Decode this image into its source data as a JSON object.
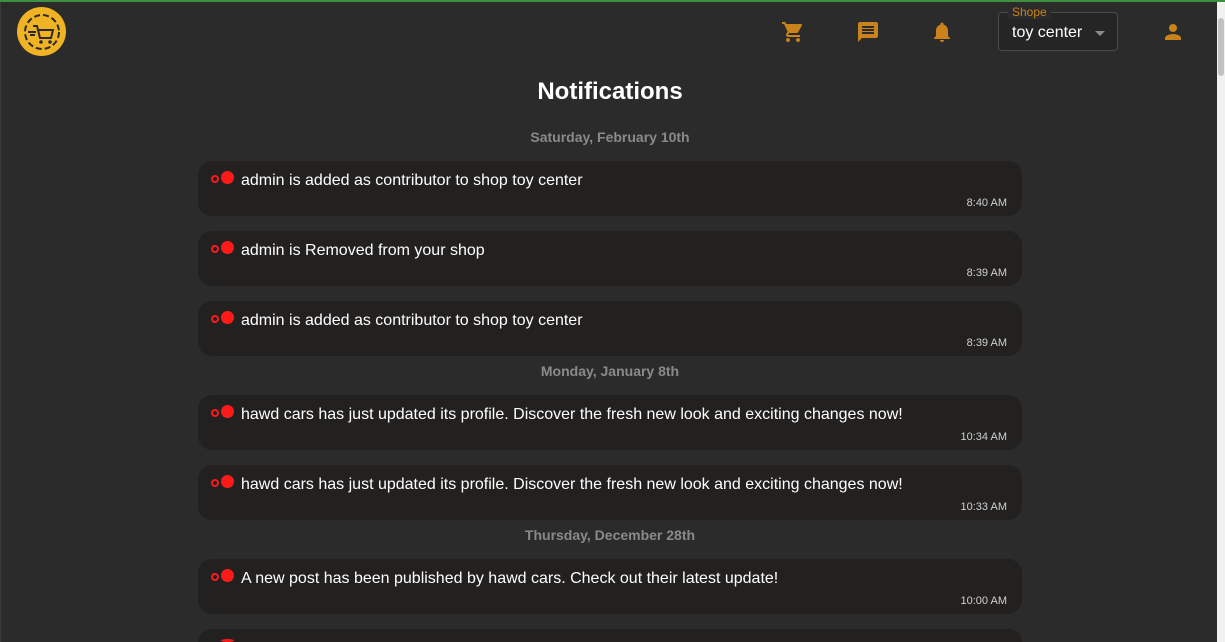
{
  "header": {
    "shop_select": {
      "label": "Shope",
      "value": "toy center"
    },
    "icons": {
      "logo": "logo-icon",
      "cart": "cart-icon",
      "chat": "chat-icon",
      "bell": "bell-icon",
      "profile": "person-icon"
    },
    "accent_color": "#c9831a"
  },
  "page": {
    "title": "Notifications"
  },
  "groups": [
    {
      "date": "Saturday, February 10th",
      "items": [
        {
          "message": "admin is added as contributor to shop toy center",
          "time": "8:40 AM"
        },
        {
          "message": "admin is Removed from your shop",
          "time": "8:39 AM"
        },
        {
          "message": "admin is added as contributor to shop toy center",
          "time": "8:39 AM"
        }
      ]
    },
    {
      "date": "Monday, January 8th",
      "items": [
        {
          "message": "hawd cars has just updated its profile. Discover the fresh new look and exciting changes now!",
          "time": "10:34 AM"
        },
        {
          "message": "hawd cars has just updated its profile. Discover the fresh new look and exciting changes now!",
          "time": "10:33 AM"
        }
      ]
    },
    {
      "date": "Thursday, December 28th",
      "items": [
        {
          "message": "A new post has been published by hawd cars. Check out their latest update!",
          "time": "10:00 AM"
        }
      ]
    }
  ],
  "colors": {
    "unread_dot": "#ff1a1a",
    "background": "#2b2b2b",
    "card": "#222120"
  }
}
